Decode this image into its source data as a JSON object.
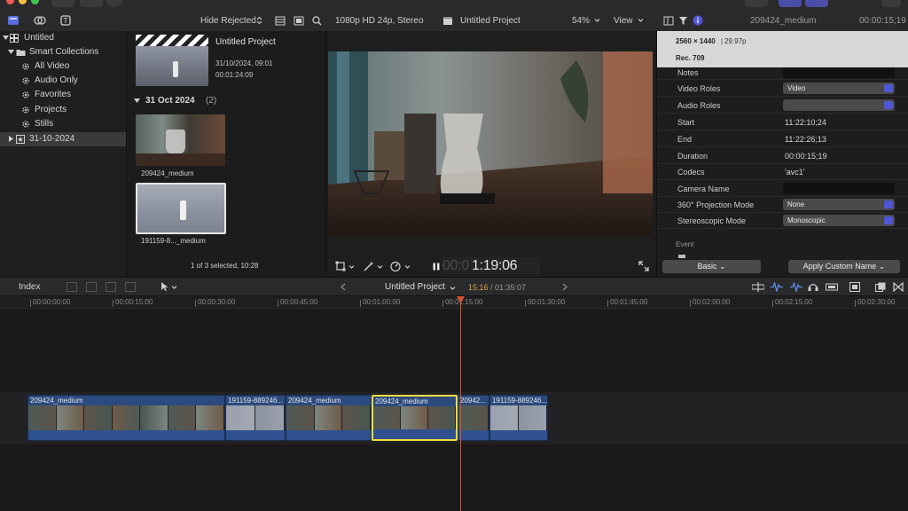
{
  "header": {
    "hide_rejected": "Hide Rejected",
    "format": "1080p HD 24p, Stereo",
    "project_title": "Untitled Project",
    "zoom": "54%",
    "view_label": "View",
    "inspector_clip": "209424_medium",
    "inspector_duration": "00:00:15;19"
  },
  "sidebar": {
    "items": [
      {
        "label": "Untitled"
      },
      {
        "label": "Smart Collections"
      },
      {
        "label": "All Video"
      },
      {
        "label": "Audio Only"
      },
      {
        "label": "Favorites"
      },
      {
        "label": "Projects"
      },
      {
        "label": "Stills"
      },
      {
        "label": "31-10-2024"
      }
    ]
  },
  "browser": {
    "project_name": "Untitled Project",
    "project_date": "31/10/2024, 09:01",
    "project_duration": "00:01:24:09",
    "group_label": "31 Oct 2024",
    "group_count": "(2)",
    "clips": [
      {
        "name": "209424_medium"
      },
      {
        "name": "191159-8..._medium"
      }
    ],
    "footer": "1 of 3 selected, 10:28"
  },
  "viewer": {
    "timecode_dim": "00:0",
    "timecode": "1:19:06"
  },
  "inspector": {
    "resolution": "2560 × 1440",
    "framerate": "29.97p",
    "colorspace": "Rec. 709",
    "rows": [
      {
        "label": "Notes",
        "value": ""
      },
      {
        "label": "Video Roles",
        "value": "Video"
      },
      {
        "label": "Audio Roles",
        "value": ""
      },
      {
        "label": "Start",
        "value": "11:22:10;24"
      },
      {
        "label": "End",
        "value": "11:22:26;13"
      },
      {
        "label": "Duration",
        "value": "00:00:15;19"
      },
      {
        "label": "Codecs",
        "value": "'avc1'"
      },
      {
        "label": "Camera Name",
        "value": ""
      },
      {
        "label": "360° Projection Mode",
        "value": "None"
      },
      {
        "label": "Stereoscopic Mode",
        "value": "Monoscopic"
      }
    ],
    "section": "Event",
    "basic_button": "Basic",
    "apply_button": "Apply Custom Name"
  },
  "timeline": {
    "index_label": "Index",
    "project_label": "Untitled Project",
    "position": "15:16",
    "total": "01:35:07",
    "ruler": [
      "00:00:00:00",
      "00:00:15:00",
      "00:00:30:00",
      "00:00:45:00",
      "00:01:00:00",
      "00:01:15:00",
      "00:01:30:00",
      "00:01:45:00",
      "00:02:00:00",
      "00:02:15:00",
      "00:02:30:00"
    ],
    "clips": [
      {
        "name": "209424_medium"
      },
      {
        "name": "191159-889246..."
      },
      {
        "name": "209424_medium"
      },
      {
        "name": "209424_medium"
      },
      {
        "name": "20942..."
      },
      {
        "name": "191159-889246..."
      }
    ]
  },
  "colors": {
    "accent": "#5056d8",
    "playhead": "#d8542c",
    "selection": "#f2dc3c",
    "clip": "#2b4a7e"
  }
}
